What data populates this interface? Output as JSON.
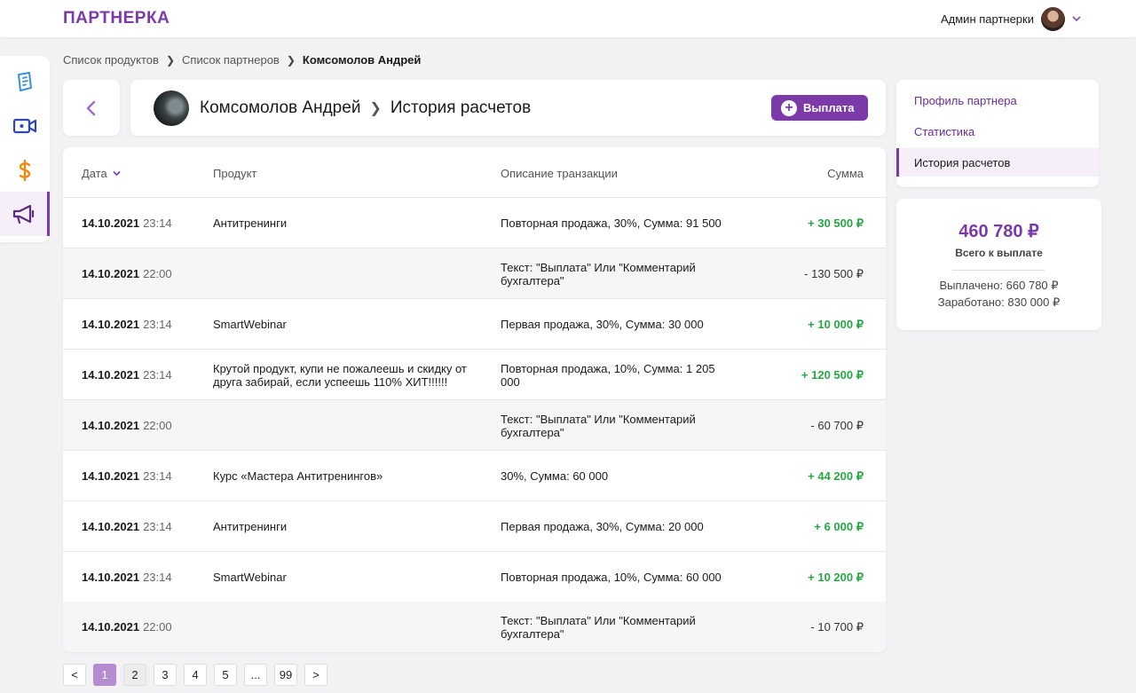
{
  "app": {
    "logo": "ПАРТНЕРКА"
  },
  "user": {
    "name": "Админ партнерки"
  },
  "breadcrumb": {
    "items": [
      "Список продуктов",
      "Список партнеров"
    ],
    "current": "Комсомолов Андрей"
  },
  "header": {
    "partner_name": "Комсомолов Андрей",
    "section": "История расчетов",
    "payout_label": "Выплата"
  },
  "table": {
    "columns": {
      "date": "Дата",
      "product": "Продукт",
      "description": "Описание транзакции",
      "sum": "Сумма"
    },
    "rows": [
      {
        "date": "14.10.2021",
        "time": "23:14",
        "product": "Антитренинги",
        "description": "Повторная продажа, 30%, Сумма: 91 500",
        "sum": "+ 30 500 ₽"
      },
      {
        "date": "14.10.2021",
        "time": "22:00",
        "product": "",
        "description": "Текст: \"Выплата\" Или \"Комментарий бухгалтера\"",
        "sum": "- 130 500 ₽"
      },
      {
        "date": "14.10.2021",
        "time": "23:14",
        "product": "SmartWebinar",
        "description": "Первая продажа, 30%, Сумма: 30 000",
        "sum": "+ 10 000 ₽"
      },
      {
        "date": "14.10.2021",
        "time": "23:14",
        "product": "Крутой продукт, купи не пожалеешь и скидку от друга забирай, если успеешь 110% ХИТ!!!!!!",
        "description": "Повторная продажа, 10%, Сумма: 1 205 000",
        "sum": "+ 120 500 ₽"
      },
      {
        "date": "14.10.2021",
        "time": "22:00",
        "product": "",
        "description": "Текст: \"Выплата\" Или \"Комментарий бухгалтера\"",
        "sum": "- 60 700  ₽"
      },
      {
        "date": "14.10.2021",
        "time": "23:14",
        "product": "Курс «Мастера Антитренингов»",
        "description": "30%, Сумма: 60 000",
        "sum": "+ 44 200 ₽"
      },
      {
        "date": "14.10.2021",
        "time": "23:14",
        "product": "Антитренинги",
        "description": "Первая продажа, 30%, Сумма: 20 000",
        "sum": "+ 6 000 ₽"
      },
      {
        "date": "14.10.2021",
        "time": "23:14",
        "product": "SmartWebinar",
        "description": "Повторная продажа, 10%, Сумма: 60 000",
        "sum": "+ 10 200 ₽"
      },
      {
        "date": "14.10.2021",
        "time": "22:00",
        "product": "",
        "description": "Текст: \"Выплата\" Или \"Комментарий бухгалтера\"",
        "sum": "- 10 700 ₽"
      }
    ]
  },
  "pagination": {
    "prev": "<",
    "next": ">",
    "pages": [
      "1",
      "2",
      "3",
      "4",
      "5",
      "...",
      "99"
    ],
    "current": "1"
  },
  "right_nav": {
    "items": [
      "Профиль партнера",
      "Статистика",
      "История расчетов"
    ],
    "active": "История расчетов"
  },
  "summary": {
    "total": "460 780 ₽",
    "total_label": "Всего к выплате",
    "paid": "Выплачено: 660 780 ₽",
    "earned": "Заработано: 830 000 ₽"
  },
  "colors": {
    "brand": "#7b3aa8",
    "positive": "#27a744",
    "active_bg": "#f6eef9",
    "page_active": "#b58ccf"
  },
  "icons": {
    "sidebar": [
      "documents-icon",
      "video-camera-icon",
      "dollar-icon",
      "megaphone-icon"
    ]
  }
}
